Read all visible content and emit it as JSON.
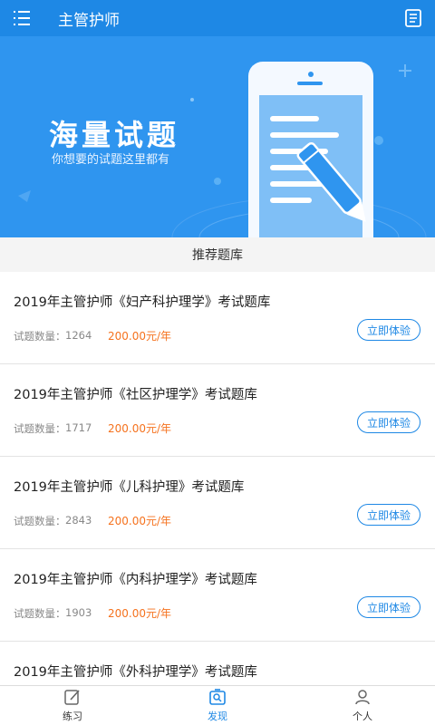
{
  "header": {
    "title": "主管护师"
  },
  "banner": {
    "title": "海量试题",
    "subtitle": "你想要的试题这里都有"
  },
  "section": {
    "title": "推荐题库"
  },
  "items": [
    {
      "title": "2019年主管护师《妇产科护理学》考试题库",
      "count_label": "试题数量：",
      "count": "1264",
      "price": "200.00元/年",
      "button": "立即体验"
    },
    {
      "title": "2019年主管护师《社区护理学》考试题库",
      "count_label": "试题数量：",
      "count": "1717",
      "price": "200.00元/年",
      "button": "立即体验"
    },
    {
      "title": "2019年主管护师《儿科护理》考试题库",
      "count_label": "试题数量：",
      "count": "2843",
      "price": "200.00元/年",
      "button": "立即体验"
    },
    {
      "title": "2019年主管护师《内科护理学》考试题库",
      "count_label": "试题数量：",
      "count": "1903",
      "price": "200.00元/年",
      "button": "立即体验"
    },
    {
      "title": "2019年主管护师《外科护理学》考试题库",
      "count_label": "",
      "count": "",
      "price": "",
      "button": ""
    }
  ],
  "tabs": [
    {
      "label": "练习",
      "icon": "edit-icon",
      "active": false
    },
    {
      "label": "发现",
      "icon": "discover-icon",
      "active": true
    },
    {
      "label": "个人",
      "icon": "person-icon",
      "active": false
    }
  ],
  "colors": {
    "primary": "#1e88e5",
    "banner": "#2f95ef",
    "price": "#f5721e"
  }
}
